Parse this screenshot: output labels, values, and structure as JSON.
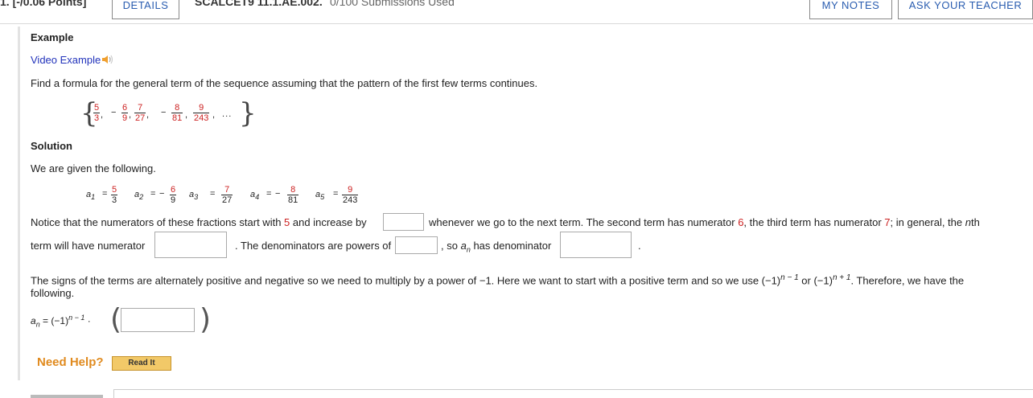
{
  "header": {
    "question_number": "1.",
    "points": "[-/0.06 Points]",
    "details_label": "DETAILS",
    "assignment_title": "SCALCET9 11.1.AE.002.",
    "submissions": "0/100 Submissions Used",
    "my_notes_label": "MY NOTES",
    "ask_teacher_label": "ASK YOUR TEACHER"
  },
  "example": {
    "heading": "Example",
    "video_link": "Video Example",
    "prompt": "Find a formula for the general term of the sequence assuming that the pattern of the first few terms continues.",
    "sequence": [
      {
        "sign": "",
        "num": "5",
        "den": "3"
      },
      {
        "sign": "−",
        "num": "6",
        "den": "9"
      },
      {
        "sign": "",
        "num": "7",
        "den": "27"
      },
      {
        "sign": "−",
        "num": "8",
        "den": "81"
      },
      {
        "sign": "",
        "num": "9",
        "den": "243"
      }
    ],
    "sequence_ellipsis": ". . ."
  },
  "solution": {
    "heading": "Solution",
    "given": "We are given the following.",
    "terms": [
      {
        "label": "a",
        "sub": "1",
        "eq": "=",
        "sign": "",
        "num": "5",
        "den": "3"
      },
      {
        "label": "a",
        "sub": "2",
        "eq": "=",
        "sign": "−",
        "num": "6",
        "den": "9"
      },
      {
        "label": "a",
        "sub": "3",
        "eq": "=",
        "sign": "",
        "num": "7",
        "den": "27"
      },
      {
        "label": "a",
        "sub": "4",
        "eq": "=",
        "sign": "−",
        "num": "8",
        "den": "81"
      },
      {
        "label": "a",
        "sub": "5",
        "eq": "=",
        "sign": "",
        "num": "9",
        "den": "243"
      }
    ],
    "line1_a": "Notice that the numerators of these fractions start with ",
    "line1_red5": "5",
    "line1_b": " and increase by",
    "line1_c": "whenever we go to the next term. The second term has numerator ",
    "line1_red6": "6",
    "line1_d": ", the third term has numerator ",
    "line1_red7": "7",
    "line1_e": "; in general, the ",
    "line1_n": "n",
    "line1_f": "th",
    "line2_a": "term will have numerator",
    "line2_b": ". The denominators are powers of",
    "line2_c": ", so ",
    "line2_a_var": "a",
    "line2_n": "n",
    "line2_d": " has denominator",
    "line2_period": ".",
    "signs_text_a": "The signs of the terms are alternately positive and negative so we need to multiply by a power of −1. Here we want to start with a positive term and so we use (−1)",
    "signs_exp1": "n − 1",
    "signs_or": " or (−1)",
    "signs_exp2": "n + 1",
    "signs_text_b": ". Therefore, we have the",
    "signs_text_c": "following.",
    "formula_lhs": "a",
    "formula_sub": "n",
    "formula_eq": "= (−1)",
    "formula_exp": "n − 1",
    "formula_dot": "·"
  },
  "help": {
    "need_help": "Need Help?",
    "read_it": "Read It"
  }
}
